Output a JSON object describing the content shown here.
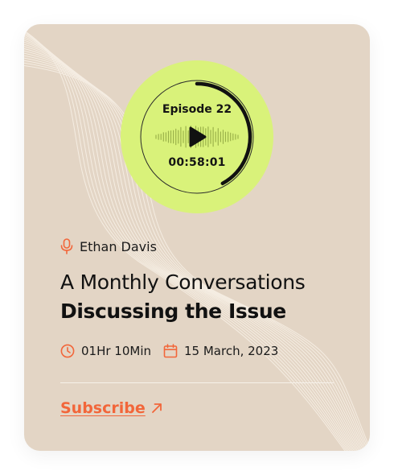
{
  "episode": {
    "label": "Episode 22",
    "timestamp": "00:58:01",
    "progress": 0.42
  },
  "host": {
    "name": "Ethan Davis"
  },
  "title": {
    "line1": "A Monthly Conversations",
    "line2": "Discussing the Issue"
  },
  "meta": {
    "duration": "01Hr 10Min",
    "date": "15 March, 2023"
  },
  "cta": {
    "label": "Subscribe"
  },
  "colors": {
    "card_bg": "#e3d5c5",
    "player_bg": "#d9f27a",
    "accent": "#f2663a",
    "text": "#111111"
  },
  "icons": {
    "host": "microphone-icon",
    "duration": "clock-icon",
    "date": "calendar-icon",
    "cta": "arrow-up-right-icon",
    "player": "play-icon"
  }
}
